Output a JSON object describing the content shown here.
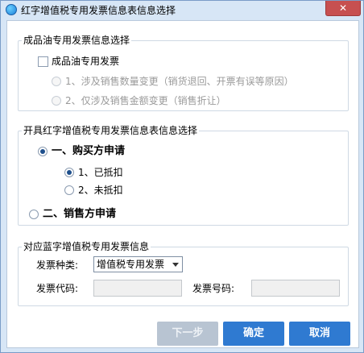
{
  "window": {
    "title": "红字增值税专用发票信息表信息选择",
    "close_label": "✕"
  },
  "group_oil": {
    "legend": "成品油专用发票信息选择",
    "checkbox_label": "成品油专用发票",
    "checkbox_checked": false,
    "option1": "1、涉及销售数量变更（销货退回、开票有误等原因）",
    "option2": "2、仅涉及销售金额变更（销售折让）"
  },
  "group_issue": {
    "legend": "开具红字增值税专用发票信息表信息选择",
    "buyer_label": "一、购买方申请",
    "buyer_selected": true,
    "deducted_label": "1、已抵扣",
    "deducted_selected": true,
    "not_deducted_label": "2、未抵扣",
    "seller_label": "二、销售方申请"
  },
  "group_blue": {
    "legend": "对应蓝字增值税专用发票信息",
    "invoice_type_label": "发票种类:",
    "invoice_type_value": "增值税专用发票",
    "invoice_code_label": "发票代码:",
    "invoice_code_value": "",
    "invoice_number_label": "发票号码:",
    "invoice_number_value": ""
  },
  "buttons": {
    "next": "下一步",
    "ok": "确定",
    "cancel": "取消"
  },
  "colors": {
    "primary_button": "#2f7ad1",
    "disabled_button": "#b8c4d2",
    "close_button": "#c75050"
  }
}
